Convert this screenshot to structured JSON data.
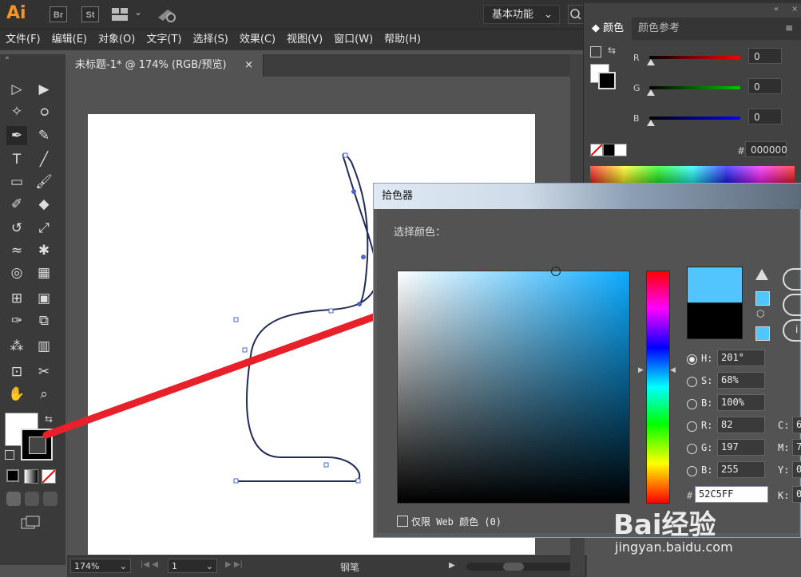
{
  "app": {
    "logo": "Ai",
    "bridge": "Br",
    "stock": "St",
    "workspace": "基本功能"
  },
  "menu": [
    "文件(F)",
    "编辑(E)",
    "对象(O)",
    "文字(T)",
    "选择(S)",
    "效果(C)",
    "视图(V)",
    "窗口(W)",
    "帮助(H)"
  ],
  "document": {
    "tab_title": "未标题-1* @ 174% (RGB/预览)",
    "close": "×"
  },
  "status": {
    "zoom": "174%",
    "page": "1",
    "tool": "钢笔"
  },
  "color_panel": {
    "tabs": [
      "颜色",
      "颜色参考"
    ],
    "channels": [
      {
        "label": "R",
        "value": "0",
        "color": "#ff0000"
      },
      {
        "label": "G",
        "value": "0",
        "color": "#00c800"
      },
      {
        "label": "B",
        "value": "0",
        "color": "#0000ff"
      }
    ],
    "hex_label": "#",
    "hex": "000000"
  },
  "picker": {
    "title": "拾色器",
    "select_label": "选择颜色：",
    "new_color": "#52c5ff",
    "old_color": "#000000",
    "fields": [
      {
        "label": "H:",
        "value": "201°",
        "checked": true
      },
      {
        "label": "S:",
        "value": "68%"
      },
      {
        "label": "B:",
        "value": "100%"
      },
      {
        "label": "R:",
        "value": "82"
      },
      {
        "label": "G:",
        "value": "197"
      },
      {
        "label": "B:",
        "value": "255"
      }
    ],
    "hex_label": "#",
    "hex": "52C5FF",
    "cmyk": [
      {
        "label": "C:",
        "value": "6"
      },
      {
        "label": "M:",
        "value": "7"
      },
      {
        "label": "Y:",
        "value": "0"
      },
      {
        "label": "K:",
        "value": "0"
      }
    ],
    "web_only": "仅限 Web 颜色 (0)"
  },
  "toolbar_colors": {
    "fill": "#ffffff",
    "stroke": "#000000"
  },
  "watermark": {
    "brand": "Bai经验",
    "url": "jingyan.baidu.com"
  }
}
